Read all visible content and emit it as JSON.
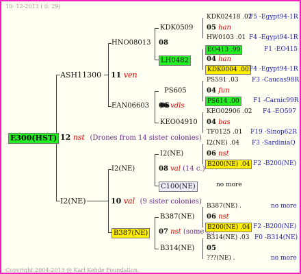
{
  "header": {
    "date": "10- 12-2013 (  0: 29)"
  },
  "footer": {
    "copyright": "Copyright 2004-2013 @ Karl Kehde Foundation."
  },
  "root": {
    "label": "E300(HST)",
    "num": "12",
    "race": "nst",
    "note": "(Drones from 14 sister colonies)"
  },
  "sire": {
    "label": "ASH11300",
    "num": "11",
    "race": "ven"
  },
  "dam": {
    "label": "I2(NE)",
    "num": "10",
    "race": "val",
    "note": "(9 sister colonies)"
  },
  "gen3": {
    "hno": "HNO08013",
    "hno_num": "08",
    "ean": "EAN06603",
    "ean_num": "06",
    "ean_race": "vdls",
    "i2ne": "I2(NE)",
    "i2ne_num": "08",
    "i2ne_race": "val",
    "i2ne_note": "(14 c.)",
    "b387": "B387(NE)",
    "b387_num": "07",
    "b387_race": "nst",
    "b387_note": "(some c.)"
  },
  "gen4": {
    "kdk": "KDK0509",
    "lh": "LH0482",
    "ps": "PS605",
    "num06": "06",
    "keo": "KEO04910",
    "i2": "I2(NE)",
    "c100": "C100(NE)",
    "b387": "B387(NE)",
    "num06b": "06",
    "b314": "B314(NE)"
  },
  "gen5": [
    {
      "name": "KDK02418 .02",
      "origin": "F5 -Egypt94-1R"
    },
    {
      "num": "05",
      "race": "han"
    },
    {
      "name": "HW0103 .01",
      "origin": "F4 -Egypt94-1R"
    },
    {
      "name": "EO413 .99",
      "origin": "F1 -EO415"
    },
    {
      "num": "04",
      "race": "han"
    },
    {
      "name": "KDK0004 .00",
      "origin": "F4 -Egypt94-1R"
    },
    {
      "name": "PS591 .03",
      "origin": "F3 -Caucas98R"
    },
    {
      "num": "04",
      "race": "fun"
    },
    {
      "name": "PS614 .00",
      "origin": "F1 -Carnic99R"
    },
    {
      "name": "KEO02906 .02",
      "origin": "F4 -EO597"
    },
    {
      "num": "04",
      "race": "bas"
    },
    {
      "name": "TF0125 .01",
      "origin": "F19 -Sinop62R"
    },
    {
      "name": "I2(NE) .04",
      "origin": "F3 -SardiniaQ"
    },
    {
      "num": "06",
      "race": "nst"
    },
    {
      "name": "B200(NE) .04",
      "origin": "F2 -B200(NE)"
    },
    {
      "name": "no more"
    },
    {
      "name": "B387(NE) .",
      "origin": "no more"
    },
    {
      "num": "06",
      "race": "nst"
    },
    {
      "name": "B200(NE) .04",
      "origin": "F2 -B200(NE)"
    },
    {
      "name": "B314(NE) .03",
      "origin": "F0 -B314(NE)"
    },
    {
      "num": "05"
    },
    {
      "name": "???(NE) .",
      "origin": "no more"
    }
  ]
}
